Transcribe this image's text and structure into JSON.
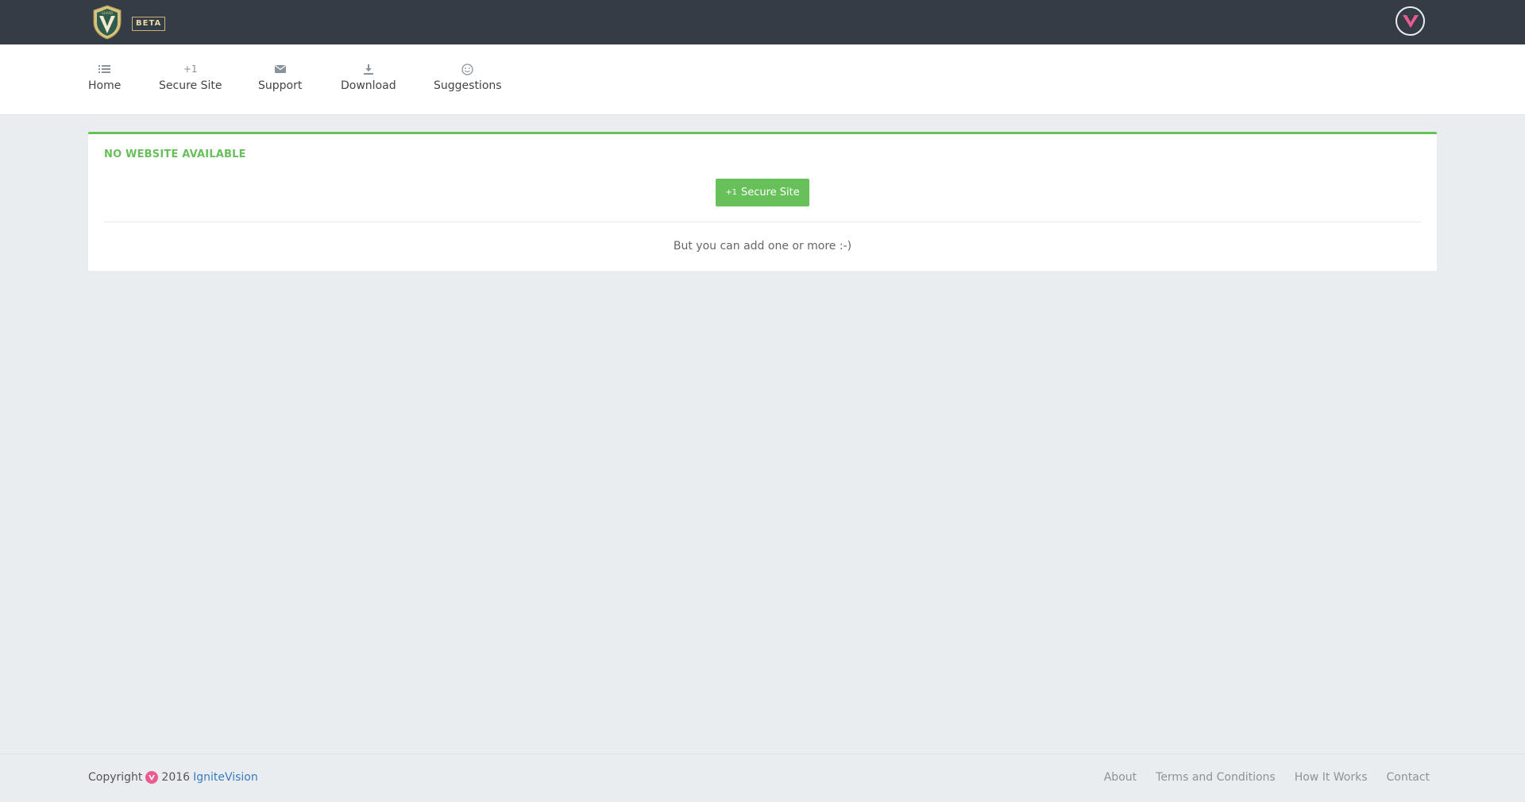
{
  "header": {
    "beta_label": "BETA",
    "logo_icon": "shield-v-logo",
    "avatar_icon": "v-avatar-icon",
    "brand_color": "#343d46"
  },
  "nav": {
    "items": [
      {
        "label": "Home",
        "icon": "list-icon"
      },
      {
        "label": "Secure Site",
        "icon": "plus-one-icon",
        "icon_text": "+1"
      },
      {
        "label": "Support",
        "icon": "envelope-icon"
      },
      {
        "label": "Download",
        "icon": "download-icon"
      },
      {
        "label": "Suggestions",
        "icon": "smiley-icon"
      }
    ]
  },
  "panel": {
    "title": "NO WEBSITE AVAILABLE",
    "button_prefix": "+1",
    "button_label": "Secure Site",
    "message": "But you can add one or more :-)",
    "accent_color": "#67c05a"
  },
  "footer": {
    "copyright_label": "Copyright",
    "year": "2016",
    "company": "IgniteVision",
    "links": [
      "About",
      "Terms and Conditions",
      "How It Works",
      "Contact"
    ]
  }
}
